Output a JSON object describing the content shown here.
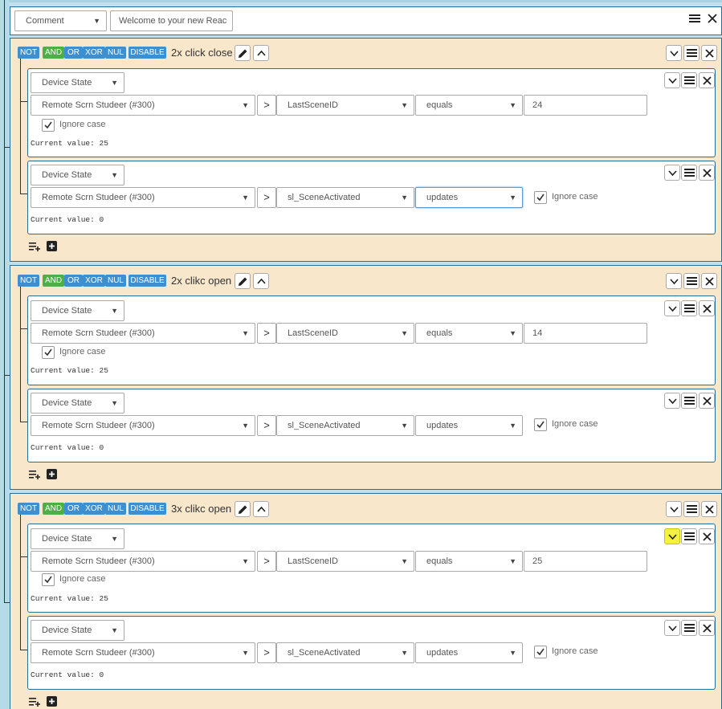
{
  "comment_row": {
    "type_select": "Comment",
    "text_value": "Welcome to your new Reac"
  },
  "logic_buttons": {
    "not": "NOT",
    "and": "AND",
    "or": "OR",
    "xor": "XOR",
    "nul": "NUL",
    "disable": "DISABLE"
  },
  "labels": {
    "ignore_case": "Ignore case",
    "greater_than": ">"
  },
  "icons": {
    "pencil": "pencil-icon",
    "chevron_up": "chevron-up-icon",
    "chevron_down": "chevron-down-icon",
    "menu": "menu-icon",
    "close": "close-icon",
    "add_condition": "add-condition-icon",
    "add_group": "add-group-icon"
  },
  "colors": {
    "border_blue": "#2a6e96",
    "group_bg": "#f8e7ca",
    "logic_blue": "#3e8fd0",
    "logic_green": "#4eae48",
    "highlight_yellow": "#f4f23e"
  },
  "groups": [
    {
      "title": "2x click close",
      "conditions": [
        {
          "type": "Device State",
          "device": "Remote Scrn Studeer (#300)",
          "attribute": "LastSceneID",
          "operator": "equals",
          "value": "24",
          "current_value": "Current value: 25"
        },
        {
          "type": "Device State",
          "device": "Remote Scrn Studeer (#300)",
          "attribute": "sl_SceneActivated",
          "operator": "updates",
          "current_value": "Current value: 0"
        }
      ]
    },
    {
      "title": "2x clikc open",
      "conditions": [
        {
          "type": "Device State",
          "device": "Remote Scrn Studeer (#300)",
          "attribute": "LastSceneID",
          "operator": "equals",
          "value": "14",
          "current_value": "Current value: 25"
        },
        {
          "type": "Device State",
          "device": "Remote Scrn Studeer (#300)",
          "attribute": "sl_SceneActivated",
          "operator": "updates",
          "current_value": "Current value: 0"
        }
      ]
    },
    {
      "title": "3x clikc open",
      "conditions": [
        {
          "type": "Device State",
          "device": "Remote Scrn Studeer (#300)",
          "attribute": "LastSceneID",
          "operator": "equals",
          "value": "25",
          "current_value": "Current value: 25"
        },
        {
          "type": "Device State",
          "device": "Remote Scrn Studeer (#300)",
          "attribute": "sl_SceneActivated",
          "operator": "updates",
          "current_value": "Current value: 0"
        }
      ]
    }
  ]
}
